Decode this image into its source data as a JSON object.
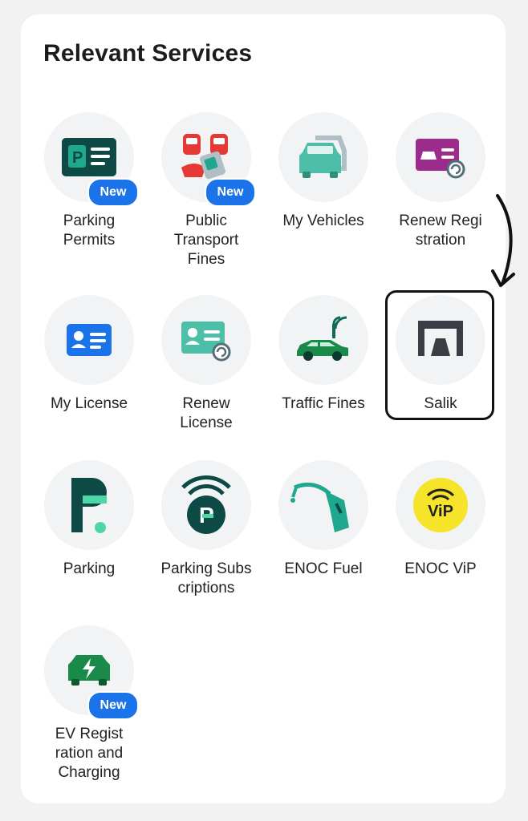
{
  "section_title": "Relevant Services",
  "badge_text": "New",
  "colors": {
    "accent": "#1a73e8",
    "teal": "#1fa88f",
    "dark_green": "#0e4a45",
    "purple": "#9c2c8c",
    "yellow": "#f5e42a"
  },
  "services": [
    {
      "label": "Parking\nPermits",
      "icon": "parking-permit-icon",
      "new": true
    },
    {
      "label": "Public\nTransport\nFines",
      "icon": "public-transport-icon",
      "new": true
    },
    {
      "label": "My Vehicles",
      "icon": "vehicles-icon",
      "new": false
    },
    {
      "label": "Renew Regi\nstration",
      "icon": "renew-registration-icon",
      "new": false
    },
    {
      "label": "My License",
      "icon": "license-card-icon",
      "new": false
    },
    {
      "label": "Renew\nLicense",
      "icon": "renew-license-icon",
      "new": false
    },
    {
      "label": "Traffic Fines",
      "icon": "traffic-fines-car-icon",
      "new": false
    },
    {
      "label": "Salik",
      "icon": "salik-toll-gate-icon",
      "new": false
    },
    {
      "label": "Parking",
      "icon": "parking-p-icon",
      "new": false
    },
    {
      "label": "Parking Subs\ncriptions",
      "icon": "parking-subscription-icon",
      "new": false
    },
    {
      "label": "ENOC Fuel",
      "icon": "fuel-nozzle-icon",
      "new": false
    },
    {
      "label": "ENOC ViP",
      "icon": "enoc-vip-icon",
      "new": false
    },
    {
      "label": "EV Regist\nration and\nCharging",
      "icon": "ev-charging-icon",
      "new": true
    }
  ],
  "vip_text": "ViP"
}
